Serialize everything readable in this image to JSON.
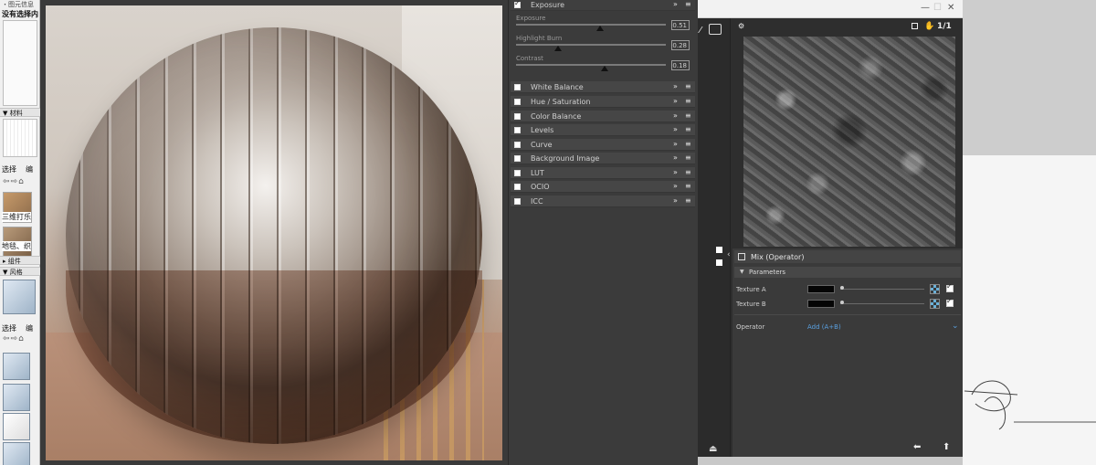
{
  "left_tray": {
    "top_line1": "・图元信息",
    "top_line2": "没有选择内",
    "materials_header": "▼ 材料",
    "tab_select_1": "选择",
    "tab_edit_1": "编",
    "thumb1_label": "三维打乐",
    "thumb2_label": "地毯、织",
    "components_header": "▸ 组件",
    "styles_header": "▼ 风格",
    "tab_select_2": "选择",
    "tab_edit_2": "编"
  },
  "properties": {
    "exposure_label": "Exposure",
    "sliders": [
      {
        "label": "Exposure",
        "value": "0.51",
        "fraction": 0.56
      },
      {
        "label": "Highlight Burn",
        "value": "0.28",
        "fraction": 0.28
      },
      {
        "label": "Contrast",
        "value": "0.18",
        "fraction": 0.59
      }
    ],
    "sections": [
      "White Balance",
      "Hue / Saturation",
      "Color Balance",
      "Levels",
      "Curve",
      "Background Image",
      "LUT",
      "OCIO",
      "ICC"
    ]
  },
  "node_window": {
    "view_ratio": "1/1",
    "node_title": "Mix (Operator)",
    "parameters_label": "Parameters",
    "texture_a_label": "Texture A",
    "texture_b_label": "Texture B",
    "operator_label": "Operator",
    "operator_value": "Add (A+B)"
  },
  "colors": {
    "panel_bg": "#3b3b3b",
    "accent_blue": "#6ab0d8",
    "link_blue": "#5aa0e0"
  }
}
